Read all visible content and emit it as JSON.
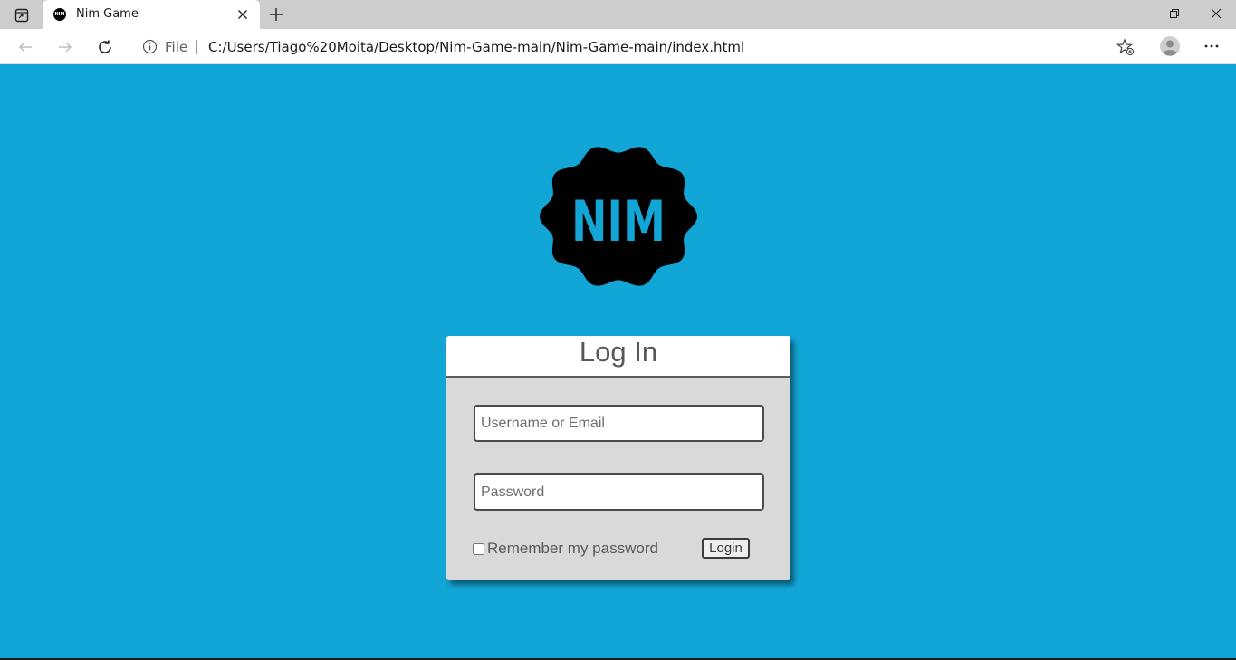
{
  "browser": {
    "tab": {
      "title": "Nim Game",
      "favicon_text": "NIM"
    },
    "address_bar": {
      "scheme_label": "File",
      "url": "C:/Users/Tiago%20Moita/Desktop/Nim-Game-main/Nim-Game-main/index.html"
    },
    "icons": {
      "tab_actions": "tab-actions-icon",
      "close_tab": "close-icon",
      "new_tab": "plus-icon",
      "minimize": "minimize-icon",
      "restore": "restore-icon",
      "close_window": "close-icon",
      "back": "back-arrow-icon",
      "forward": "forward-arrow-icon",
      "refresh": "refresh-icon",
      "site_info": "info-icon",
      "favorites": "star-plus-icon",
      "profile": "profile-icon",
      "menu": "more-icon"
    }
  },
  "page": {
    "background_color": "#12a6d6",
    "logo": {
      "text": "NIM",
      "badge_color": "#000000",
      "text_color": "#12a6d6"
    },
    "login": {
      "title": "Log In",
      "username_placeholder": "Username or Email",
      "password_placeholder": "Password",
      "remember_label": "Remember my password",
      "remember_checked": false,
      "submit_label": "Login"
    }
  }
}
